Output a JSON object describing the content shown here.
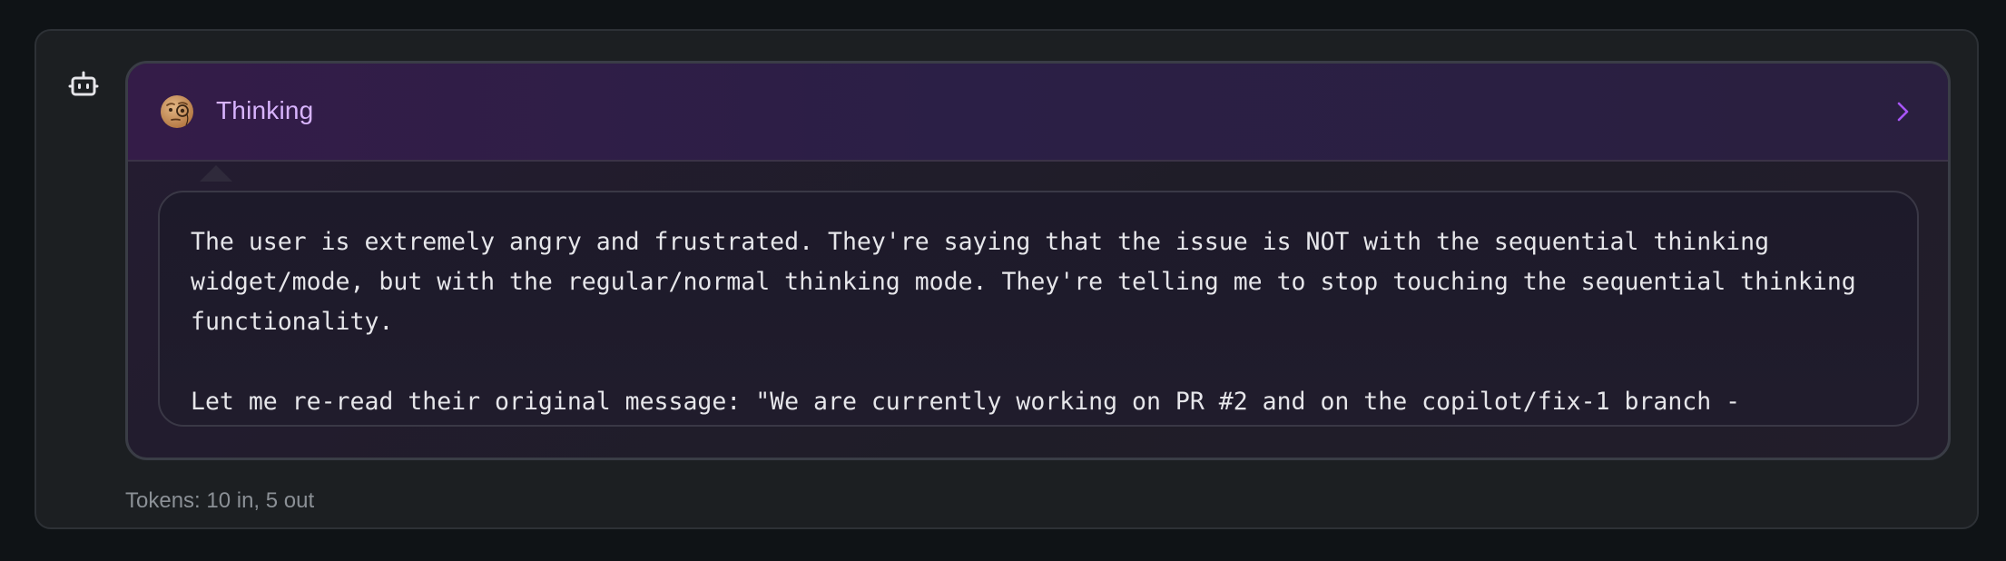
{
  "message": {
    "thinking": {
      "title": "Thinking",
      "icon": "monocle-face-icon",
      "paragraphs": [
        "The user is extremely angry and frustrated. They're saying that the issue is NOT with the sequential thinking widget/mode, but with the regular/normal thinking mode. They're telling me to stop touching the sequential thinking functionality.",
        "Let me re-read their original message: \"We are currently working on PR #2 and on the copilot/fix-1 branch -"
      ]
    },
    "tokens": "Tokens: 10 in, 5 out"
  },
  "colors": {
    "accent": "#d8b4fe",
    "chevron": "#a855f7",
    "background": "#0f1316",
    "card": "#1c1f22"
  }
}
